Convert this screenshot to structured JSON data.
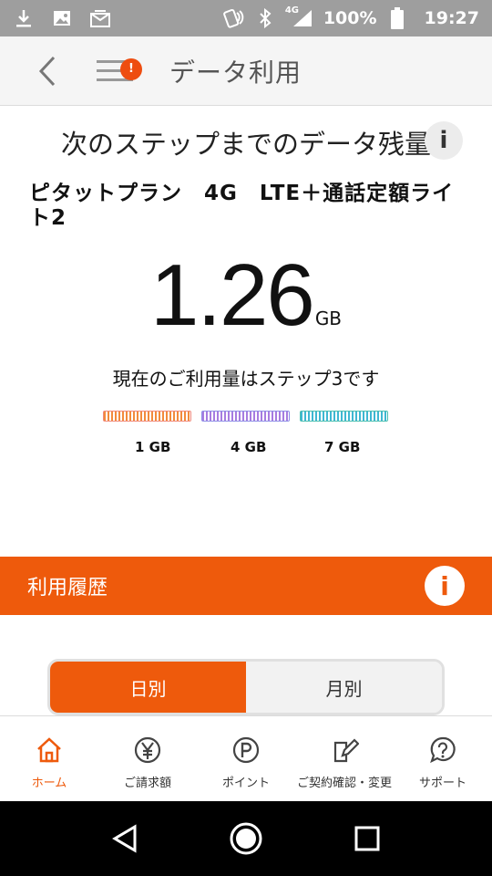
{
  "status_bar": {
    "battery_text": "100%",
    "time": "19:27",
    "network": "4G"
  },
  "app_bar": {
    "title": "データ利用",
    "menu_badge": "!"
  },
  "card": {
    "title": "次のステップまでのデータ残量",
    "info_icon": "i",
    "plan_name": "ピタットプラン　4G　LTE＋通話定額ライト2",
    "remaining_value": "1.26",
    "remaining_unit": "GB",
    "step_text": "現在のご利用量はステップ3です",
    "steps": [
      {
        "label": "1 GB",
        "color": "#f28b3c"
      },
      {
        "label": "4 GB",
        "color": "#a77ce0"
      },
      {
        "label": "7 GB",
        "color": "#3fb7d2"
      }
    ]
  },
  "history": {
    "title": "利用履歴",
    "info_icon": "i",
    "tabs": [
      {
        "label": "日別",
        "active": true
      },
      {
        "label": "月別",
        "active": false
      }
    ]
  },
  "bottom_nav": {
    "items": [
      {
        "label": "ホーム",
        "icon": "home-icon",
        "active": true
      },
      {
        "label": "ご請求額",
        "icon": "yen-icon",
        "active": false
      },
      {
        "label": "ポイント",
        "icon": "point-icon",
        "active": false
      },
      {
        "label": "ご契約確認・変更",
        "icon": "contract-edit-icon",
        "active": false
      },
      {
        "label": "サポート",
        "icon": "support-icon",
        "active": false
      }
    ]
  },
  "colors": {
    "accent": "#ee5a0c",
    "status_bar": "#9e9e9e"
  }
}
